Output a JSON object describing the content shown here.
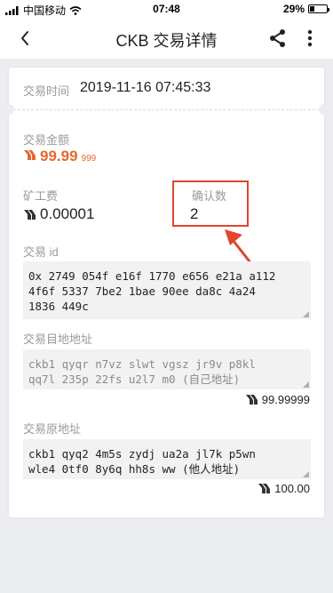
{
  "status_bar": {
    "carrier": "中国移动",
    "time": "07:48",
    "battery": "29%",
    "battery_level": 0.29
  },
  "nav": {
    "title": "CKB 交易详情",
    "back_icon": "chevron-left-icon",
    "share_icon": "share-icon",
    "more_icon": "more-vertical-icon"
  },
  "transaction": {
    "time_label": "交易时间",
    "time_value": "2019-11-16 07:45:33",
    "amount_label": "交易金额",
    "amount_main": "99.99",
    "amount_sub": "999",
    "fee_label": "矿工费",
    "fee_value": "0.00001",
    "confirm_label": "确认数",
    "confirm_value": "2",
    "id_label": "交易 id",
    "id_value": "0x 2749 054f e16f 1770 e656 e21a a112\n4f6f 5337 7be2 1bae 90ee da8c 4a24\n1836 449c",
    "dest_label": "交易目地地址",
    "dest_value": "ckb1 qyqr n7vz slwt vgsz jr9v p8kl\nqq7l 235p 22fs u2l7 m0 (自己地址)",
    "dest_amount": "99.99999",
    "source_label": "交易原地址",
    "source_value": "ckb1 qyq2 4m5s zydj ua2a jl7k p5wn\nwle4 0tf0 8y6q hh8s ww (他人地址)",
    "source_amount": "100.00"
  },
  "colors": {
    "accent": "#e36a2d",
    "highlight": "#e2442f",
    "background": "#ecedf0"
  }
}
